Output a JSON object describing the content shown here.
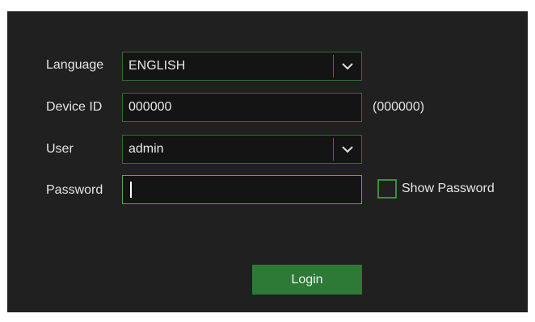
{
  "form": {
    "language": {
      "label": "Language",
      "value": "ENGLISH"
    },
    "device_id": {
      "label": "Device ID",
      "value": "000000",
      "hint": "(000000)"
    },
    "user": {
      "label": "User",
      "value": "admin"
    },
    "password": {
      "label": "Password",
      "value": ""
    },
    "show_password": {
      "label": "Show Password",
      "checked": false
    },
    "login_label": "Login"
  },
  "colors": {
    "panel_bg": "#202020",
    "field_bg": "#141414",
    "accent_green": "#2c7a35",
    "border_green": "#2f6f33"
  },
  "icons": [
    "chevron-down-icon"
  ]
}
